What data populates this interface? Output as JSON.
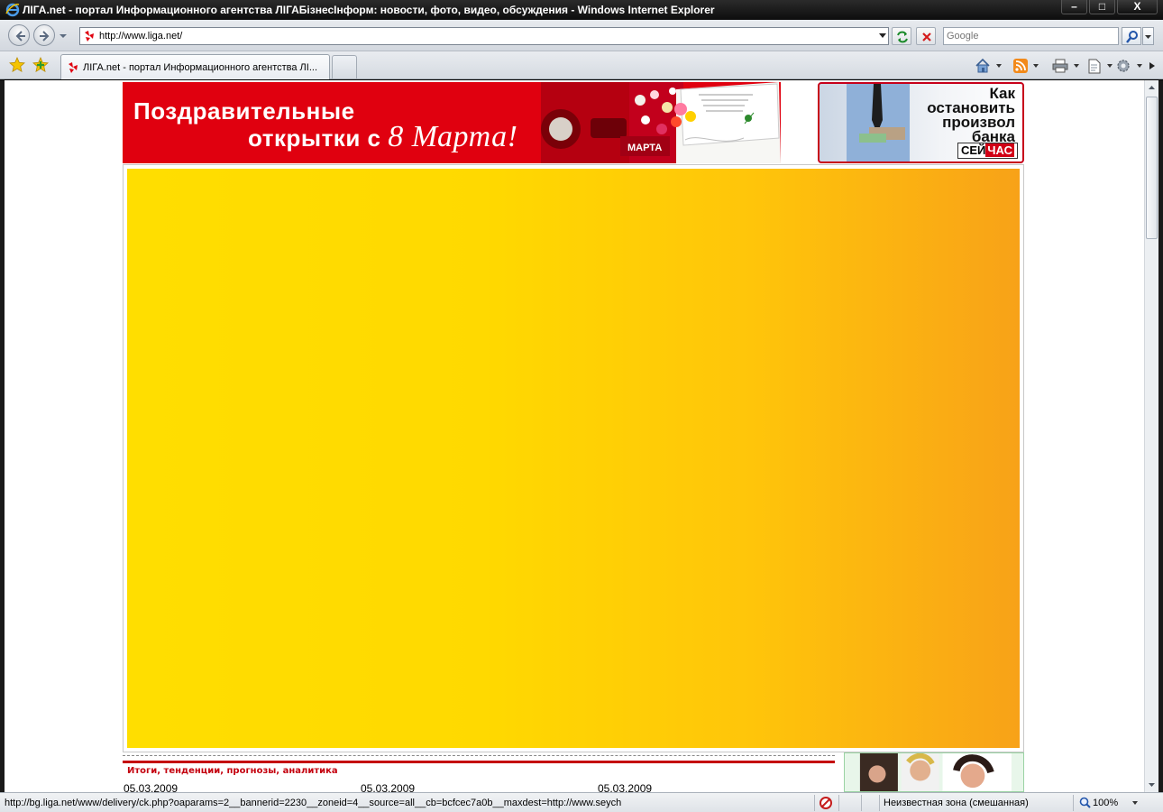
{
  "window": {
    "title": "ЛІГА.net - портал Информационного агентства ЛІГАБізнесІнформ: новости, фото, видео, обсуждения - Windows Internet Explorer",
    "minimize": "–",
    "maximize": "□",
    "close": "X"
  },
  "navbar": {
    "url": "http://www.liga.net/",
    "search_placeholder": "Google"
  },
  "tabs": [
    {
      "label": "ЛІГА.net - портал Информационного агентства ЛІ..."
    }
  ],
  "page": {
    "banner_left": {
      "line1": "Поздравительные",
      "line2_prefix": "открытки с ",
      "line2_script": "8 Марта!"
    },
    "banner_right": {
      "lines": [
        "Как",
        "остановить",
        "произвол",
        "банка"
      ],
      "logo_left": "СЕЙ",
      "logo_right": "ЧАС"
    },
    "section_title": "Итоги, тенденции, прогнозы, аналитика",
    "dates": [
      "05.03.2009",
      "05.03.2009",
      "05.03.2009"
    ]
  },
  "statusbar": {
    "url": "http://bg.liga.net/www/delivery/ck.php?oaparams=2__bannerid=2230__zoneid=4__source=all__cb=bcfcec7a0b__maxdest=http://www.seych",
    "zone": "Неизвестная зона (смешанная)",
    "zoom": "100%"
  },
  "icons": {
    "back": "back-arrow-icon",
    "forward": "forward-arrow-icon",
    "refresh": "refresh-icon",
    "stop": "stop-icon",
    "search": "search-icon",
    "favorites": "star-icon",
    "add_favorites": "add-favorites-icon",
    "home": "home-icon",
    "feeds": "rss-icon",
    "print": "print-icon",
    "page": "page-icon",
    "tools": "gear-icon"
  },
  "colors": {
    "brand_red": "#e0000f",
    "ad_yellow": "#ffde00",
    "ad_orange": "#f8a218"
  }
}
